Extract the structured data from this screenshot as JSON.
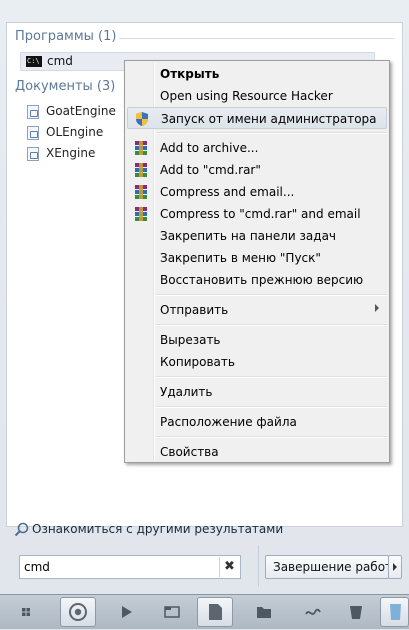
{
  "results": {
    "programs_header": "Программы (1)",
    "program_item": "cmd",
    "program_icon_text": "C:\\",
    "documents_header": "Документы (3)",
    "documents": [
      "GoatEngine",
      "OLEngine",
      "XEngine"
    ]
  },
  "context_menu": {
    "items": [
      {
        "label": "Открыть",
        "icon": "none"
      },
      {
        "label": "Open using Resource Hacker",
        "icon": "none"
      },
      {
        "label": "Запуск от имени администратора",
        "icon": "uac-shield-icon"
      },
      {
        "label": "Add to archive...",
        "icon": "winrar-icon"
      },
      {
        "label": "Add to \"cmd.rar\"",
        "icon": "winrar-icon"
      },
      {
        "label": "Compress and email...",
        "icon": "winrar-icon"
      },
      {
        "label": "Compress to \"cmd.rar\" and email",
        "icon": "winrar-icon"
      },
      {
        "label": "Закрепить на панели задач",
        "icon": "none"
      },
      {
        "label": "Закрепить в меню \"Пуск\"",
        "icon": "none"
      },
      {
        "label": "Восстановить прежнюю версию",
        "icon": "none"
      },
      {
        "label": "Отправить",
        "icon": "none"
      },
      {
        "label": "Вырезать",
        "icon": "none"
      },
      {
        "label": "Копировать",
        "icon": "none"
      },
      {
        "label": "Удалить",
        "icon": "none"
      },
      {
        "label": "Расположение файла",
        "icon": "none"
      },
      {
        "label": "Свойства",
        "icon": "none"
      }
    ]
  },
  "more_results": "Ознакомиться с другими результатами",
  "search": {
    "value": "cmd",
    "clear_glyph": "✖"
  },
  "shutdown": {
    "label": "Завершение работы"
  },
  "taskbar": {
    "buttons": [
      "windows-icon",
      "chrome-icon",
      "media-player-icon",
      "explorer-icon",
      "document-icon",
      "folder-icon",
      "network-icon",
      "bin-icon",
      "app-icon"
    ]
  }
}
